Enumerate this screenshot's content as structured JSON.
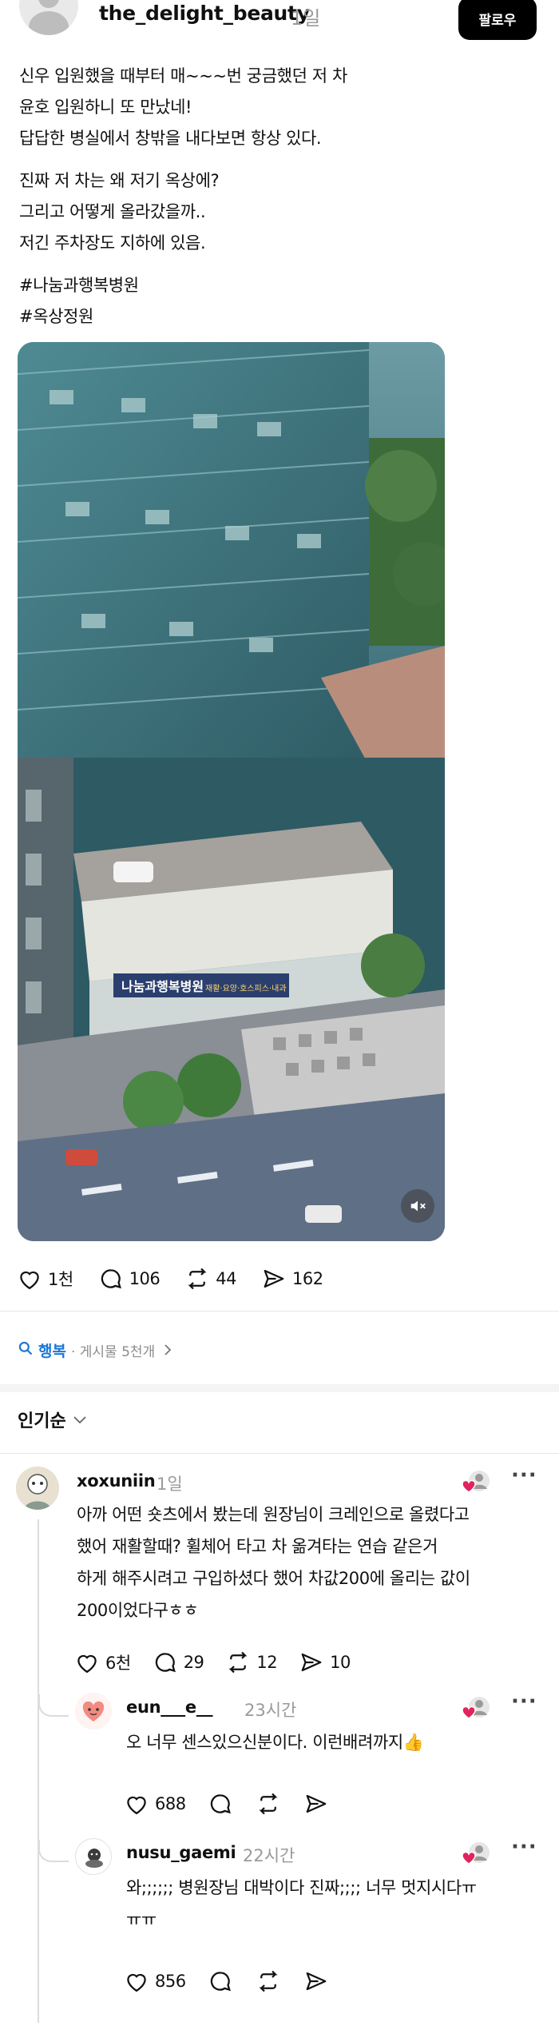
{
  "post": {
    "username": "the_delight_beauty",
    "time": "1일",
    "follow_label": "팔로우",
    "caption_lines": [
      "신우 입원했을 때부터 매~~~번 궁금했던 저 차",
      "윤호 입원하니 또 만났네!",
      "답답한 병실에서 창밖을 내다보면 항상 있다.",
      "",
      "진짜 저 차는 왜 저기 옥상에?",
      "그리고 어떻게 올라갔을까..",
      "저긴 주차장도 지하에 있음.",
      "",
      "#나눔과행복병원",
      "#옥상정원"
    ],
    "media": {
      "sign_text": "나눔과행복병원",
      "sign_sub": "재활·요양·호스피스·내과",
      "mute_icon": "speaker-muted-icon"
    },
    "stats": {
      "likes": "1천",
      "comments": "106",
      "reposts": "44",
      "shares": "162"
    }
  },
  "topic": {
    "name": "행복",
    "meta": "· 게시물 5천개"
  },
  "sort": {
    "label": "인기순"
  },
  "comments": [
    {
      "username": "xoxuniin",
      "time": "1일",
      "lines": [
        "아까 어떤 숏츠에서 봤는데 원장님이 크레인으로 올렸다고",
        "했어 재활할때? 휠체어 타고 차 옮겨타는 연습 같은거",
        "하게 해주시려고 구입하셨다 했어 차값200에 올리는 값이",
        "200이었다구ㅎㅎ"
      ],
      "likes": "6천",
      "comments": "29",
      "reposts": "12",
      "shares": "10"
    },
    {
      "username": "eun___e__",
      "time": "23시간",
      "lines": [
        "오 너무 센스있으신분이다. 이런배려까지👍"
      ],
      "likes": "688",
      "comments": "",
      "reposts": "",
      "shares": ""
    },
    {
      "username": "nusu_gaemi",
      "time": "22시간",
      "lines": [
        "와;;;;;; 병원장님 대박이다 진짜;;;; 너무 멋지시다ㅠ",
        "ㅠㅠ"
      ],
      "likes": "856",
      "comments": "",
      "reposts": "",
      "shares": ""
    }
  ],
  "colors": {
    "accent_blue": "#1877d6",
    "text": "#101010",
    "muted": "#9a9a9a",
    "heart_red": "#e0245e"
  }
}
